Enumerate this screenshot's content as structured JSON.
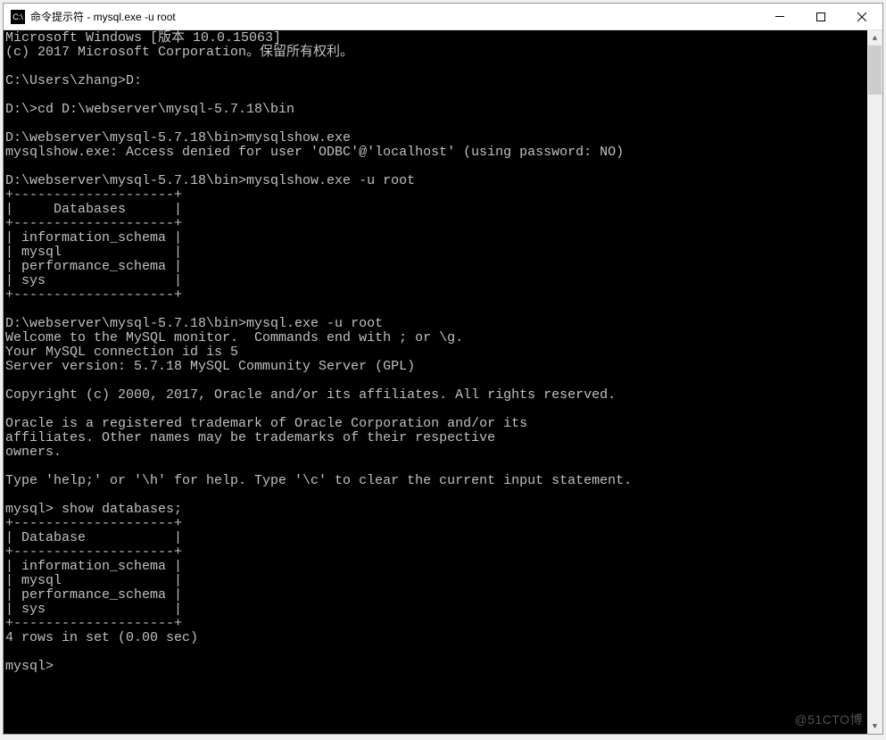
{
  "titlebar": {
    "icon_label": "C:\\",
    "title": "命令提示符 - mysql.exe  -u root"
  },
  "terminal": {
    "lines": {
      "l0": "Microsoft Windows [版本 10.0.15063]",
      "l1": "(c) 2017 Microsoft Corporation。保留所有权利。",
      "l2": "",
      "l3": "C:\\Users\\zhang>D:",
      "l4": "",
      "l5": "D:\\>cd D:\\webserver\\mysql-5.7.18\\bin",
      "l6": "",
      "l7": "D:\\webserver\\mysql-5.7.18\\bin>mysqlshow.exe",
      "l8": "mysqlshow.exe: Access denied for user 'ODBC'@'localhost' (using password: NO)",
      "l9": "",
      "l10": "D:\\webserver\\mysql-5.7.18\\bin>mysqlshow.exe -u root",
      "l11": "+--------------------+",
      "l12": "|     Databases      |",
      "l13": "+--------------------+",
      "l14": "| information_schema |",
      "l15": "| mysql              |",
      "l16": "| performance_schema |",
      "l17": "| sys                |",
      "l18": "+--------------------+",
      "l19": "",
      "l20": "D:\\webserver\\mysql-5.7.18\\bin>mysql.exe -u root",
      "l21": "Welcome to the MySQL monitor.  Commands end with ; or \\g.",
      "l22": "Your MySQL connection id is 5",
      "l23": "Server version: 5.7.18 MySQL Community Server (GPL)",
      "l24": "",
      "l25": "Copyright (c) 2000, 2017, Oracle and/or its affiliates. All rights reserved.",
      "l26": "",
      "l27": "Oracle is a registered trademark of Oracle Corporation and/or its",
      "l28": "affiliates. Other names may be trademarks of their respective",
      "l29": "owners.",
      "l30": "",
      "l31": "Type 'help;' or '\\h' for help. Type '\\c' to clear the current input statement.",
      "l32": "",
      "l33": "mysql> show databases;",
      "l34": "+--------------------+",
      "l35": "| Database           |",
      "l36": "+--------------------+",
      "l37": "| information_schema |",
      "l38": "| mysql              |",
      "l39": "| performance_schema |",
      "l40": "| sys                |",
      "l41": "+--------------------+",
      "l42": "4 rows in set (0.00 sec)",
      "l43": "",
      "l44": "mysql>"
    }
  },
  "watermark": "@51CTO博"
}
